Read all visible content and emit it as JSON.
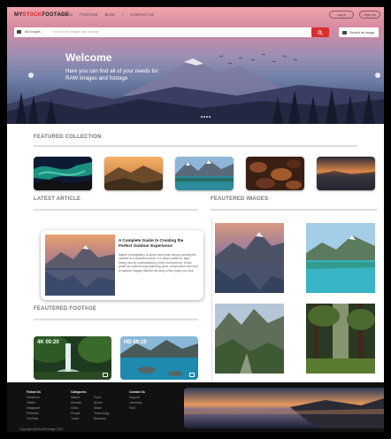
{
  "header": {
    "logo_part1": "MY",
    "logo_part2": "STOCK",
    "logo_part3": "FOOTAGE",
    "nav": [
      "IMAGES",
      "FOOTAGE",
      "BLOG",
      "CONTACT US"
    ],
    "login_label": "Log in",
    "signup_label": "Sign Up"
  },
  "search": {
    "category": "All Images",
    "placeholder": "Search for images and footage",
    "search_by_image_label": "Search by image"
  },
  "hero": {
    "title": "Welcome",
    "tagline": "Here you can find all of your needs for RAW images and footage"
  },
  "sections": {
    "featured_collection": "FEATURED COLLECTION",
    "latest_article": "LATEST ARTICLE",
    "featured_images": "FEAUTERED IMAGES",
    "featured_footage": "FEAUTERED FOOTAGE"
  },
  "article": {
    "title": "A Complete Guide to Creating the Perfect Outdoor Experience",
    "body": "Nature photography is about more than simply pointing the camera at a beautiful scene. It is about patience, light, timing and an understanding of the environment. In this guide we walk through planning, gear, composition and how to capture images that tell the story of the place you visit."
  },
  "footage": [
    {
      "label": "4K 00:20"
    },
    {
      "label": "HD 00:10"
    }
  ],
  "footer": {
    "col1_heading": "Follow Us",
    "col1_items": [
      "Facebook",
      "Twitter",
      "Instagram",
      "Pinterest",
      "YouTube"
    ],
    "col2_heading": "Categories",
    "col2_items": [
      "Nature",
      "Animals",
      "Cities",
      "People",
      "Travel"
    ],
    "col3_items": [
      "Food",
      "Sports",
      "Music",
      "Technology",
      "Business"
    ],
    "col4_heading": "Contact Us",
    "col4_items": [
      "Support",
      "Licensing",
      "FAQ"
    ],
    "copyright": "Copyright MyStockFootage 2021"
  },
  "colors": {
    "accent": "#d8302e",
    "footer_bg": "#111111"
  }
}
